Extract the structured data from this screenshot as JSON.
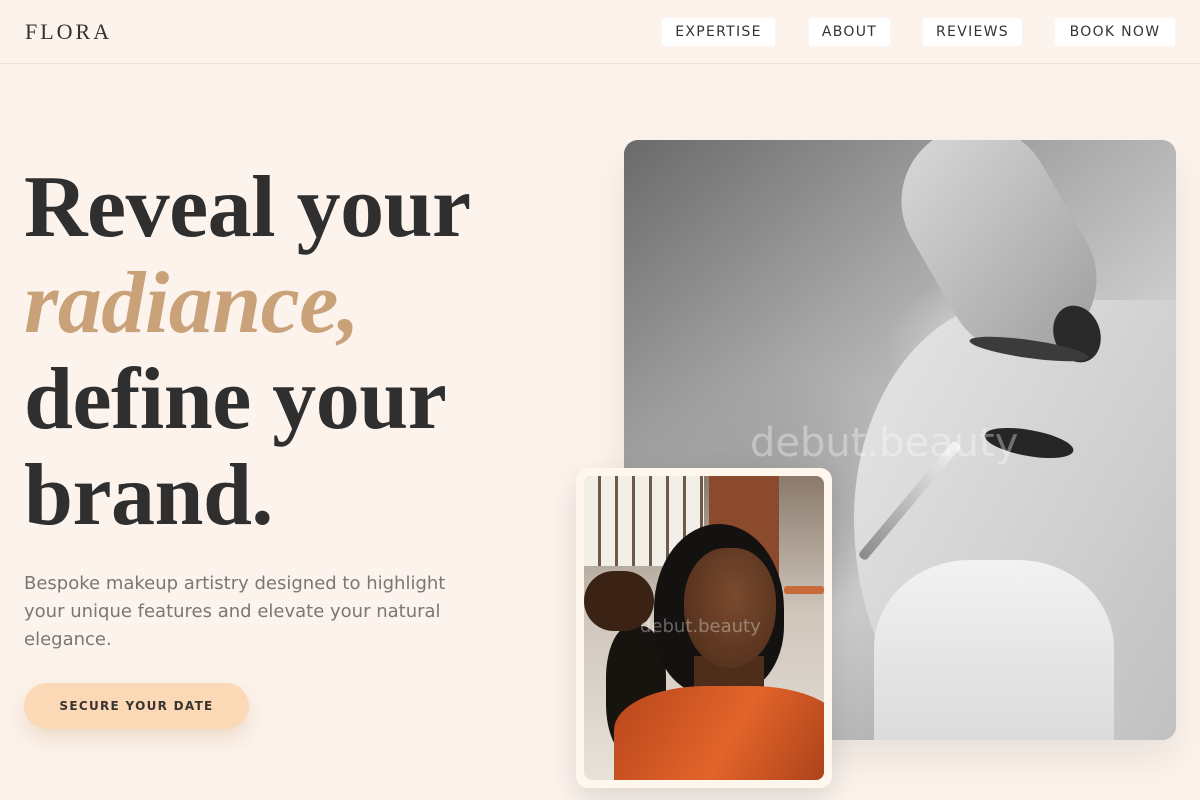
{
  "brand": {
    "logo": "FLORA"
  },
  "nav": {
    "items": [
      {
        "label": "EXPERTISE"
      },
      {
        "label": "ABOUT"
      },
      {
        "label": "REVIEWS"
      },
      {
        "label": "BOOK NOW"
      }
    ]
  },
  "hero": {
    "headline_line1": "Reveal your",
    "headline_accent": "radiance,",
    "headline_line3": "define your",
    "headline_line4": "brand.",
    "subtext": "Bespoke makeup artistry designed to highlight your unique features and elevate your natural elegance.",
    "cta_label": "SECURE YOUR DATE"
  },
  "images": {
    "main_watermark": "debut.beauty",
    "small_watermark": "debut.beauty"
  },
  "colors": {
    "background": "#fcf3ec",
    "accent_text": "#c9a27a",
    "cta_background": "#fbd8b6",
    "text_dark": "#2f2f2f",
    "text_muted": "#7d7570"
  }
}
